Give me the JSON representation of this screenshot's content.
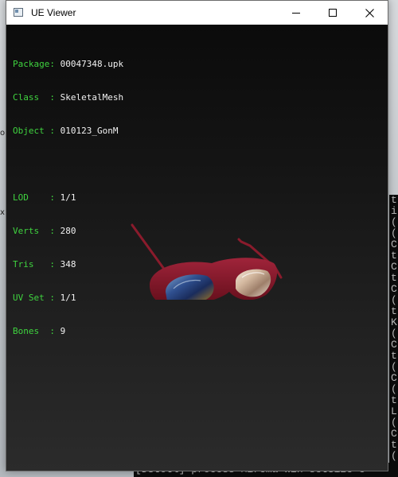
{
  "window": {
    "title": "UE Viewer"
  },
  "info": {
    "package": {
      "label": "Package",
      "sep": ":",
      "value": "00047348.upk"
    },
    "class": {
      "label": "Class  ",
      "sep": ":",
      "value": "SkeletalMesh"
    },
    "object": {
      "label": "Object ",
      "sep": ":",
      "value": "010123_GonM"
    },
    "lod": {
      "label": "LOD    ",
      "sep": ":",
      "value": "1/1"
    },
    "verts": {
      "label": "Verts  ",
      "sep": ":",
      "value": "280"
    },
    "tris": {
      "label": "Tris   ",
      "sep": ":",
      "value": "348"
    },
    "uvset": {
      "label": "UV Set ",
      "sep": ":",
      "value": "1/1"
    },
    "bones": {
      "label": "Bones  ",
      "sep": ":",
      "value": "9"
    }
  },
  "background": {
    "console_strip": "[DStotl] process  Mirema win setSize  e",
    "console_lines": [
      "t",
      "i",
      "(",
      "(",
      "C",
      "t",
      "C",
      "t",
      "C",
      "(",
      "t",
      "K",
      "(",
      "C",
      "t",
      "(",
      "C",
      "(",
      "t",
      "L",
      "(",
      "C",
      "t",
      "(",
      "C"
    ],
    "marks": [
      "o",
      "x"
    ]
  },
  "icons": {
    "minimize": "minimize-icon",
    "maximize": "maximize-icon",
    "close": "close-icon",
    "app": "app-window-icon"
  },
  "colors": {
    "info_label": "#3fd33f",
    "info_value": "#f2f2f2",
    "frame": "#7a1020"
  }
}
